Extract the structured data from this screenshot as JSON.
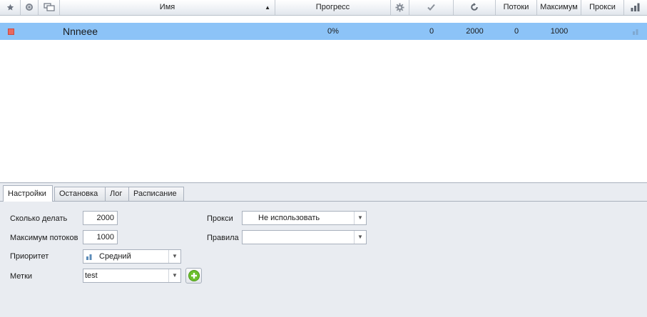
{
  "grid": {
    "columns": {
      "favorite_icon": "star-icon",
      "globe_icon": "globe-icon",
      "windows_icon": "windows-icon",
      "name": "Имя",
      "progress": "Прогресс",
      "settings_icon": "gear-icon",
      "done_icon": "checkmark-icon",
      "repeat_icon": "refresh-icon",
      "threads": "Потоки",
      "maximum": "Максимум",
      "proxy": "Прокси",
      "priority_icon": "signal-bars-icon"
    },
    "rows": [
      {
        "status_icon": "stop-square-icon",
        "status_color": "#e8685f",
        "name": "Nnneee",
        "progress": "0%",
        "done": "0",
        "repeat": "2000",
        "threads": "0",
        "maximum": "1000",
        "proxy": "",
        "selected_color": "#8cc3f7"
      }
    ]
  },
  "tabs": [
    "Настройки",
    "Остановка",
    "Лог",
    "Расписание"
  ],
  "active_tab": "Настройки",
  "settings": {
    "count_label": "Сколько делать",
    "count_value": "2000",
    "max_threads_label": "Максимум потоков",
    "max_threads_value": "1000",
    "priority_label": "Приоритет",
    "priority_value": "Средний",
    "tags_label": "Метки",
    "tags_value": "test",
    "proxy_label": "Прокси",
    "proxy_value": "Не использовать",
    "rules_label": "Правила",
    "rules_value": ""
  },
  "colors": {
    "accent_add": "#6cbf2c",
    "selection": "#8cc3f7"
  }
}
